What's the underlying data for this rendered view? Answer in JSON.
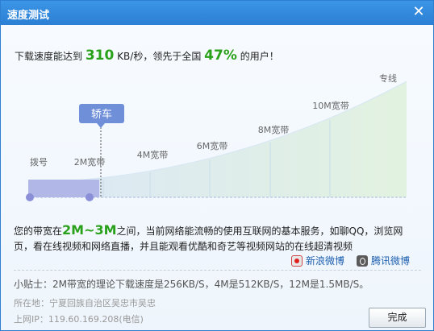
{
  "window": {
    "title": "速度测试"
  },
  "speed": {
    "prefix": "下载速度能达到",
    "value": "310",
    "unit": "KB/秒，领先于全国",
    "percent": "47%",
    "suffix": "的用户！"
  },
  "scale": {
    "tiers": [
      "拨号",
      "2M宽带",
      "4M宽带",
      "6M宽带",
      "8M宽带",
      "10M宽带",
      "专线"
    ],
    "marker_label": "轿车",
    "current_fraction": 0.28
  },
  "description": {
    "prefix": "您的带宽在",
    "range": "2M~3M",
    "text": "之间，当前网络能流畅的使用互联网的基本服务，如聊QQ，浏览网页，看在线视频和网络直播，并且能观看优酷和奇艺等视频网站的在线超清视频"
  },
  "share": {
    "weibo_label": "新浪微博",
    "tencent_label": "腾讯微博"
  },
  "tip": "小贴士：2M带宽的理论下载速度是256KB/S，4M是512KB/S，12M是1.5MB/S。",
  "location": "所在地：宁夏回族自治区吴忠市吴忠",
  "ip": "上网IP：119.60.169.208(电信)",
  "buttons": {
    "done": "完成"
  },
  "colors": {
    "accent": "#2aa11b",
    "title_bar": "#2b7fd4",
    "marker": "#6f8fd8"
  }
}
